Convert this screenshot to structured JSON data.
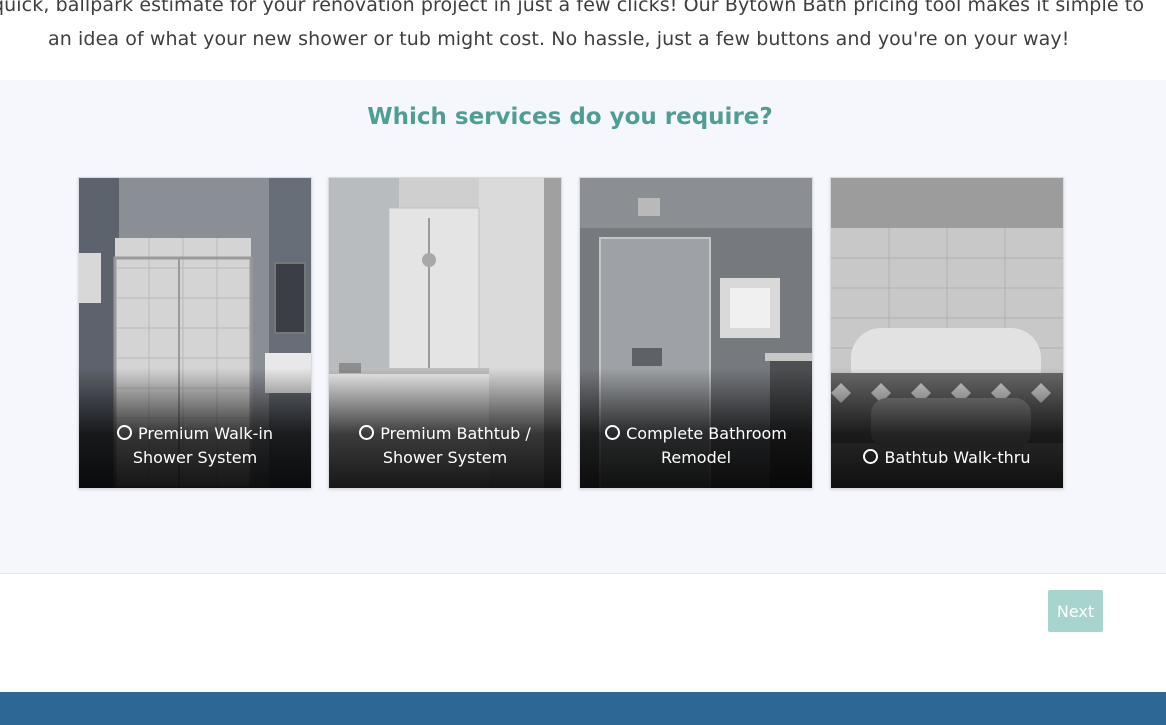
{
  "intro": {
    "line1": "quick, ballpark estimate for your renovation project in just a few clicks! Our Bytown Bath pricing tool makes it simple to",
    "line2": "an idea of what your new shower or tub might cost. No hassle, just a few buttons and you're on your way!"
  },
  "quiz": {
    "title": "Which services do you require?",
    "options": [
      {
        "label_line1": "Premium Walk-in",
        "label_line2": "Shower System",
        "selected": false,
        "icon": "radio-unchecked-icon"
      },
      {
        "label_line1": "Premium Bathtub /",
        "label_line2": "Shower System",
        "selected": false,
        "icon": "radio-unchecked-icon"
      },
      {
        "label_line1": "Complete Bathroom",
        "label_line2": "Remodel",
        "selected": false,
        "icon": "radio-unchecked-icon"
      },
      {
        "label_line1": "Bathtub Walk-thru",
        "label_line2": "",
        "selected": false,
        "icon": "radio-unchecked-icon"
      }
    ]
  },
  "navigation": {
    "next_label": "Next"
  },
  "colors": {
    "accent_title": "#4f9e93",
    "next_button_disabled": "#a8d4ce",
    "footer_band": "#2c6795",
    "quiz_background": "#f5f7fd"
  }
}
